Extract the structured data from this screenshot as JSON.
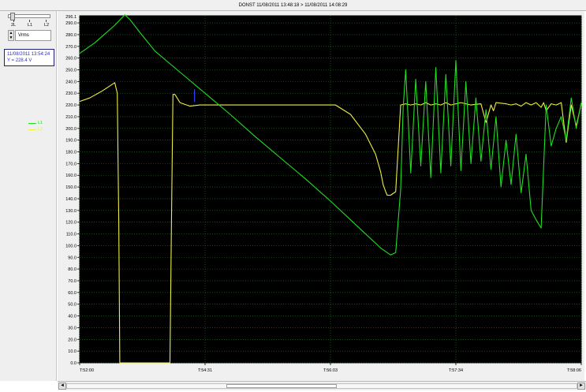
{
  "window": {
    "title": "DONST 11/08/2011 13:48:18 > 11/08/2011 14:08:29"
  },
  "left_panel": {
    "slider_ticks": [
      "2L",
      "L1",
      "L2"
    ],
    "channel_select": {
      "value": "Vrms"
    },
    "cursor_readout": {
      "time": "11/08/2011 13:54:24",
      "value": "Y = 228.4 V"
    },
    "legend": [
      {
        "label": "L1",
        "color": "#22dd22"
      },
      {
        "label": "L2",
        "color": "#eeee44"
      }
    ]
  },
  "scrollbar": {
    "left_arrow": "◄",
    "right_arrow": "►",
    "position": 0.4
  },
  "chart_data": {
    "type": "line",
    "background": "#000000",
    "grid": true,
    "grid_color": "#1f7f1f",
    "ylim": [
      0.0,
      296.1
    ],
    "ymax_label": "296.1",
    "y_ticks": [
      0,
      10,
      20,
      30,
      40,
      50,
      60,
      70,
      80,
      90,
      100,
      110,
      120,
      130,
      140,
      150,
      160,
      170,
      180,
      190,
      200,
      210,
      220,
      230,
      240,
      250,
      260,
      270,
      280,
      290
    ],
    "y_tick_labels": [
      "0.0",
      "10.0",
      "20.0",
      "30.0",
      "40.0",
      "50.0",
      "60.0",
      "70.0",
      "80.0",
      "90.0",
      "100.0",
      "110.0",
      "120.0",
      "130.0",
      "140.0",
      "150.0",
      "160.0",
      "170.0",
      "180.0",
      "190.0",
      "200.0",
      "210.0",
      "220.0",
      "230.0",
      "240.0",
      "250.0",
      "260.0",
      "270.0",
      "280.0",
      "290.0"
    ],
    "xlim": [
      0,
      1
    ],
    "x_ticks": [
      0.0,
      0.25,
      0.5,
      0.75,
      1.0
    ],
    "x_tick_labels": [
      "T:52:00",
      "T:54:31",
      "T:56:03",
      "T:57:34",
      "T:58:06"
    ],
    "cursor_x": 0.229,
    "series": [
      {
        "name": "L2",
        "color": "#eeee44",
        "x": [
          0.0,
          0.02,
          0.045,
          0.07,
          0.075,
          0.078,
          0.08,
          0.18,
          0.183,
          0.186,
          0.19,
          0.2,
          0.22,
          0.24,
          0.26,
          0.3,
          0.35,
          0.4,
          0.45,
          0.5,
          0.51,
          0.54,
          0.57,
          0.59,
          0.6,
          0.605,
          0.61,
          0.613,
          0.62,
          0.63,
          0.64,
          0.65,
          0.66,
          0.67,
          0.68,
          0.69,
          0.7,
          0.71,
          0.72,
          0.73,
          0.74,
          0.75,
          0.76,
          0.78,
          0.8,
          0.81,
          0.82,
          0.825,
          0.83,
          0.85,
          0.86,
          0.87,
          0.88,
          0.89,
          0.9,
          0.91,
          0.92,
          0.925,
          0.93,
          0.94,
          0.95,
          0.96,
          0.97,
          0.98,
          0.99,
          1.0
        ],
        "y": [
          223,
          226,
          232,
          239,
          230,
          120,
          0,
          0,
          120,
          229,
          229,
          222,
          219,
          220,
          220,
          220,
          220,
          220,
          220,
          220,
          220,
          212,
          195,
          178,
          163,
          152,
          146,
          143,
          143,
          146,
          220,
          221,
          220,
          221,
          220,
          222,
          220,
          221,
          220,
          222,
          220,
          221,
          222,
          220,
          221,
          205,
          220,
          215,
          222,
          221,
          220,
          221,
          219,
          222,
          220,
          222,
          218,
          222,
          215,
          221,
          220,
          222,
          188,
          220,
          202,
          221
        ]
      },
      {
        "name": "L1",
        "color": "#22dd22",
        "x": [
          0.0,
          0.03,
          0.07,
          0.09,
          0.1,
          0.12,
          0.15,
          0.2,
          0.25,
          0.3,
          0.35,
          0.4,
          0.45,
          0.5,
          0.55,
          0.6,
          0.62,
          0.63,
          0.64,
          0.645,
          0.65,
          0.66,
          0.67,
          0.68,
          0.69,
          0.7,
          0.71,
          0.72,
          0.73,
          0.74,
          0.75,
          0.76,
          0.77,
          0.78,
          0.79,
          0.8,
          0.81,
          0.82,
          0.83,
          0.84,
          0.85,
          0.86,
          0.87,
          0.88,
          0.89,
          0.9,
          0.91,
          0.92,
          0.93,
          0.94,
          0.95,
          0.96,
          0.97,
          0.98,
          0.99,
          1.0
        ],
        "y": [
          264,
          273,
          288,
          297,
          293,
          282,
          266,
          248,
          230,
          212,
          193,
          175,
          157,
          138,
          118,
          98,
          92,
          94,
          148,
          218,
          250,
          162,
          242,
          168,
          240,
          158,
          252,
          162,
          246,
          168,
          258,
          164,
          240,
          170,
          226,
          172,
          216,
          165,
          210,
          150,
          190,
          152,
          195,
          145,
          178,
          130,
          122,
          115,
          220,
          185,
          200,
          210,
          190,
          226,
          200,
          222
        ]
      }
    ]
  }
}
